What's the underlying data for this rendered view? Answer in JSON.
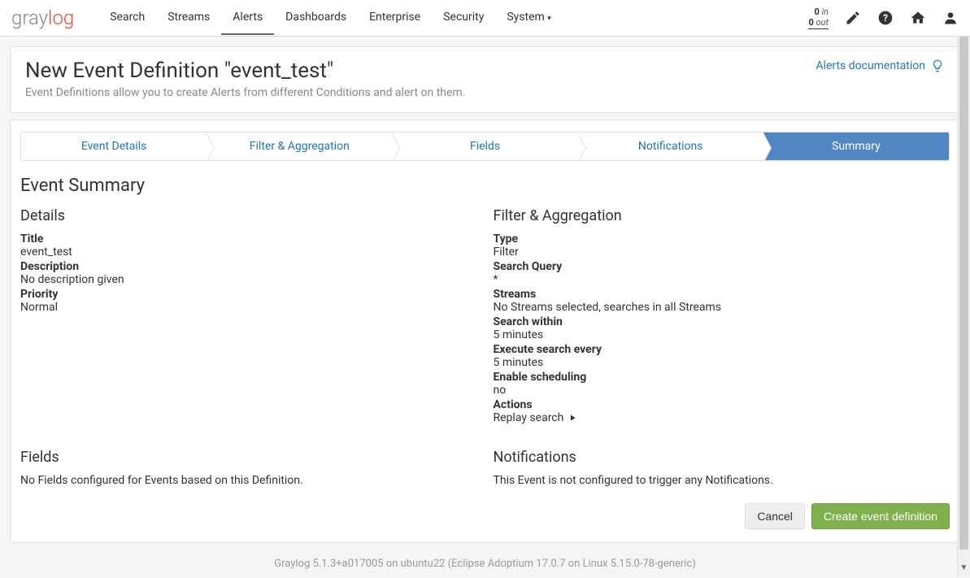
{
  "nav": {
    "logo_gray": "gray",
    "logo_log": "log",
    "items": [
      "Search",
      "Streams",
      "Alerts",
      "Dashboards",
      "Enterprise",
      "Security",
      "System"
    ],
    "active_index": 2,
    "throughput_in_num": "0",
    "throughput_in_unit": "in",
    "throughput_out_num": "0",
    "throughput_out_unit": "out"
  },
  "header": {
    "title": "New Event Definition \"event_test\"",
    "subtitle": "Event Definitions allow you to create Alerts from different Conditions and alert on them.",
    "doc_link": "Alerts documentation"
  },
  "steps": [
    "Event Details",
    "Filter & Aggregation",
    "Fields",
    "Notifications",
    "Summary"
  ],
  "summary": {
    "section_title": "Event Summary",
    "details": {
      "heading": "Details",
      "title_label": "Title",
      "title_value": "event_test",
      "desc_label": "Description",
      "desc_value": "No description given",
      "prio_label": "Priority",
      "prio_value": "Normal"
    },
    "filter": {
      "heading": "Filter & Aggregation",
      "type_label": "Type",
      "type_value": "Filter",
      "query_label": "Search Query",
      "query_value": "*",
      "streams_label": "Streams",
      "streams_value": "No Streams selected, searches in all Streams",
      "within_label": "Search within",
      "within_value": "5 minutes",
      "every_label": "Execute search every",
      "every_value": "5 minutes",
      "sched_label": "Enable scheduling",
      "sched_value": "no",
      "actions_label": "Actions",
      "replay_label": "Replay search"
    },
    "fields": {
      "heading": "Fields",
      "text": "No Fields configured for Events based on this Definition."
    },
    "notifications": {
      "heading": "Notifications",
      "text": "This Event is not configured to trigger any Notifications."
    }
  },
  "buttons": {
    "cancel": "Cancel",
    "create": "Create event definition"
  },
  "footer": "Graylog 5.1.3+a017005 on ubuntu22 (Eclipse Adoptium 17.0.7 on Linux 5.15.0-78-generic)"
}
